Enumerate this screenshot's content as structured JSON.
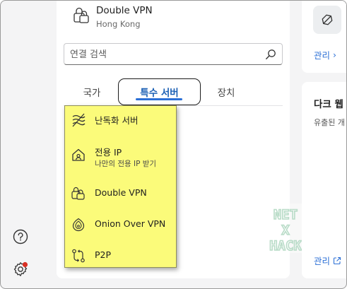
{
  "vpn": {
    "title": "Double VPN",
    "location": "Hong Kong"
  },
  "search": {
    "placeholder": "연결 검색"
  },
  "tabs": {
    "country": "국가",
    "special": "특수 서버",
    "device": "장치"
  },
  "special_menu": {
    "items": [
      {
        "label": "난독화 서버",
        "icon": "obfuscated-icon"
      },
      {
        "label": "전용 IP",
        "sublabel": "나만의 전용 IP 받기",
        "icon": "dedicated-ip-icon"
      },
      {
        "label": "Double VPN",
        "icon": "double-vpn-lock-icon"
      },
      {
        "label": "Onion Over VPN",
        "icon": "onion-icon"
      },
      {
        "label": "P2P",
        "icon": "p2p-icon"
      }
    ],
    "background": "#fbfb7a"
  },
  "right_panel": {
    "manage_label": "관리",
    "dark_web_title": "다크 웹",
    "dark_web_desc": "유출된 개",
    "manage_bottom_label": "관리"
  },
  "watermark": {
    "lines": [
      "NET",
      "X",
      "HACK"
    ]
  },
  "colors": {
    "accent": "#2b6fd6",
    "notification_dot": "#d93025"
  }
}
